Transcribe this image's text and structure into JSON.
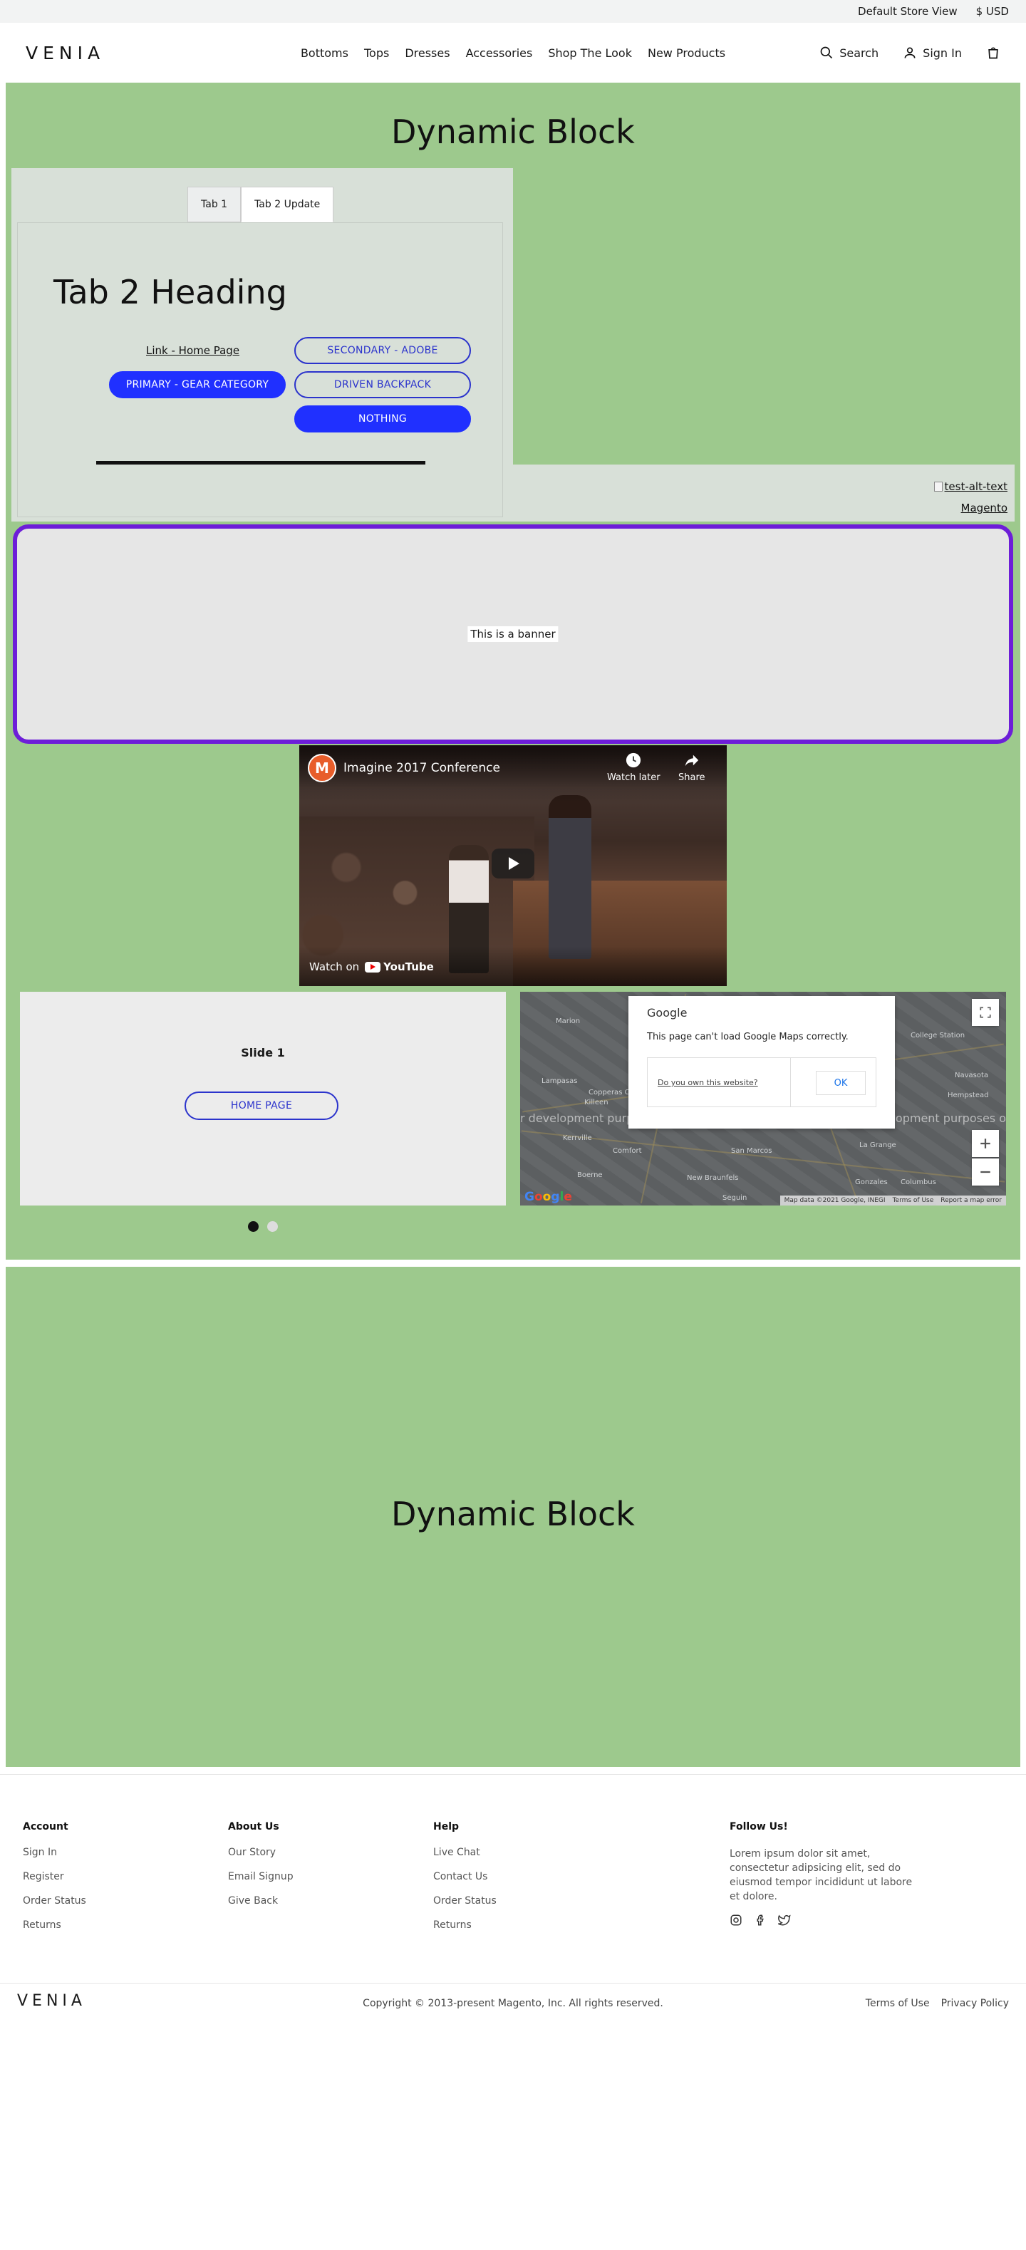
{
  "topbar": {
    "store_view": "Default Store View",
    "currency": "$ USD"
  },
  "header": {
    "logo": "VENIA",
    "nav": [
      "Bottoms",
      "Tops",
      "Dresses",
      "Accessories",
      "Shop The Look",
      "New Products"
    ],
    "search_label": "Search",
    "signin_label": "Sign In"
  },
  "block1": {
    "title": "Dynamic Block",
    "tabs": [
      "Tab 1",
      "Tab 2 Update"
    ],
    "tab_heading": "Tab 2 Heading",
    "link_home": "Link - Home Page",
    "btn_secondary": "SECONDARY - ADOBE",
    "btn_primary": "PRIMARY - GEAR CATEGORY",
    "btn_driven": "DRIVEN BACKPACK",
    "btn_nothing": "NOTHING",
    "img_alt": "test-alt-text",
    "img_link": "Magento",
    "banner_text": "This is a banner",
    "video": {
      "title": "Imagine 2017 Conference",
      "watch_later": "Watch later",
      "share": "Share",
      "watch_on": "Watch on",
      "youtube": "YouTube"
    },
    "slide": {
      "title": "Slide 1",
      "button": "HOME PAGE"
    },
    "map": {
      "google": "Google",
      "message": "This page can't load Google Maps correctly.",
      "own_site": "Do you own this website?",
      "ok": "OK",
      "dev_left": "r development purposes",
      "dev_right": "development purposes o",
      "labels": [
        "Marion",
        "College Station",
        "Navasota",
        "Hempstead",
        "Lampasas",
        "Killeen",
        "Copperas Cove",
        "Kerrville",
        "Comfort",
        "San Marcos",
        "La Grange",
        "Boerne",
        "New Braunfels",
        "Seguin",
        "Columbus",
        "Gonzales"
      ],
      "footer_data": "Map data ©2021 Google, INEGI",
      "footer_terms": "Terms of Use",
      "footer_report": "Report a map error"
    }
  },
  "block2": {
    "title": "Dynamic Block"
  },
  "footer": {
    "account": {
      "heading": "Account",
      "links": [
        "Sign In",
        "Register",
        "Order Status",
        "Returns"
      ]
    },
    "about": {
      "heading": "About Us",
      "links": [
        "Our Story",
        "Email Signup",
        "Give Back"
      ]
    },
    "help": {
      "heading": "Help",
      "links": [
        "Live Chat",
        "Contact Us",
        "Order Status",
        "Returns"
      ]
    },
    "follow": {
      "heading": "Follow Us!",
      "text": "Lorem ipsum dolor sit amet, consectetur adipsicing elit, sed do eiusmod tempor incididunt ut labore et dolore."
    },
    "logo": "VENIA",
    "copyright": "Copyright © 2013-present Magento, Inc. All rights reserved.",
    "terms": "Terms of Use",
    "privacy": "Privacy Policy"
  },
  "colors": {
    "green": "#9dc98d",
    "accent": "#2030ff",
    "banner_border": "#6d1ed8"
  }
}
